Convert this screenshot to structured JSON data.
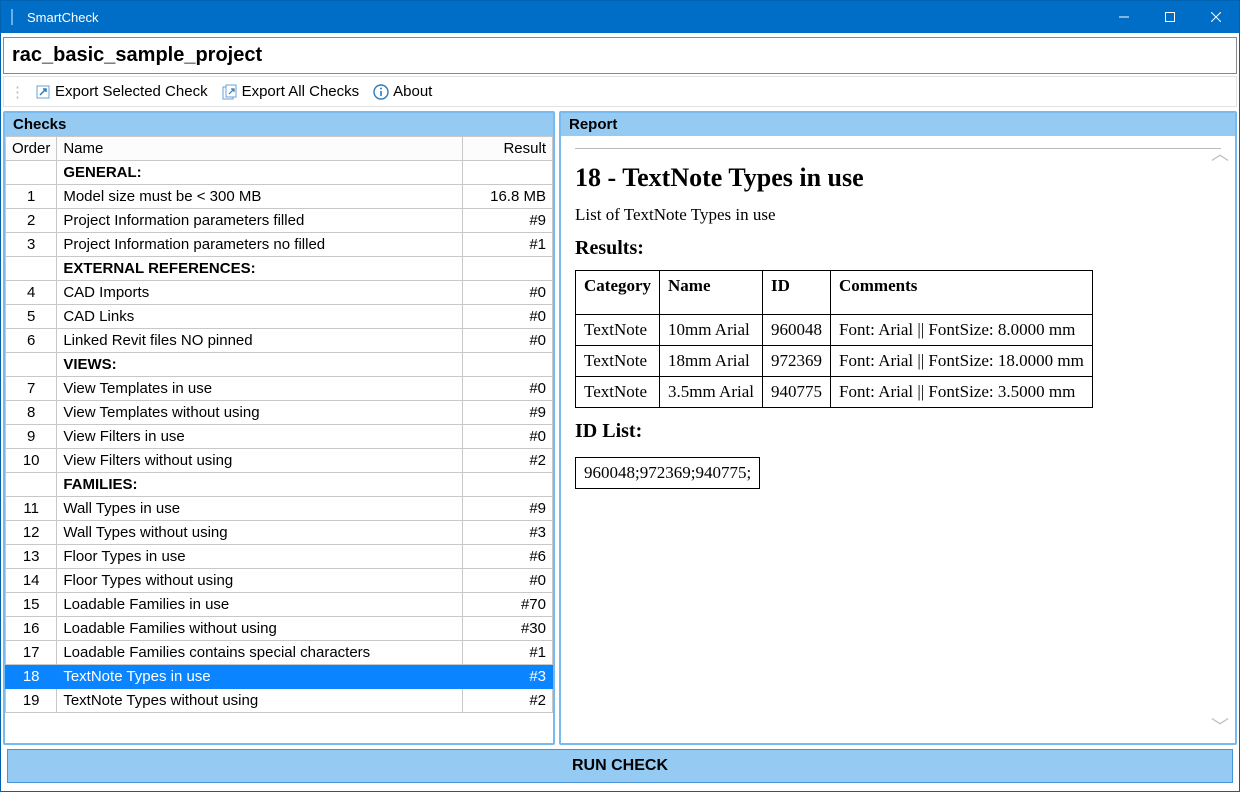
{
  "window": {
    "title": "SmartCheck"
  },
  "project": {
    "name": "rac_basic_sample_project"
  },
  "toolbar": {
    "export_selected": "Export Selected Check",
    "export_all": "Export All Checks",
    "about": "About"
  },
  "panels": {
    "checks_title": "Checks",
    "report_title": "Report"
  },
  "grid": {
    "headers": {
      "order": "Order",
      "name": "Name",
      "result": "Result"
    },
    "rows": [
      {
        "type": "section",
        "name": "GENERAL:"
      },
      {
        "type": "item",
        "order": "1",
        "name": "Model size must be < 300 MB",
        "result": "16.8 MB"
      },
      {
        "type": "item",
        "order": "2",
        "name": "Project Information parameters filled",
        "result": "#9"
      },
      {
        "type": "item",
        "order": "3",
        "name": "Project Information parameters no filled",
        "result": "#1"
      },
      {
        "type": "section",
        "name": "EXTERNAL REFERENCES:"
      },
      {
        "type": "item",
        "order": "4",
        "name": "CAD Imports",
        "result": "#0"
      },
      {
        "type": "item",
        "order": "5",
        "name": "CAD Links",
        "result": "#0"
      },
      {
        "type": "item",
        "order": "6",
        "name": "Linked Revit files NO pinned",
        "result": "#0"
      },
      {
        "type": "section",
        "name": "VIEWS:"
      },
      {
        "type": "item",
        "order": "7",
        "name": "View Templates in use",
        "result": "#0"
      },
      {
        "type": "item",
        "order": "8",
        "name": "View Templates without using",
        "result": "#9"
      },
      {
        "type": "item",
        "order": "9",
        "name": "View Filters in use",
        "result": "#0"
      },
      {
        "type": "item",
        "order": "10",
        "name": "View Filters without using",
        "result": "#2"
      },
      {
        "type": "section",
        "name": "FAMILIES:"
      },
      {
        "type": "item",
        "order": "11",
        "name": "Wall Types in use",
        "result": "#9"
      },
      {
        "type": "item",
        "order": "12",
        "name": "Wall Types without using",
        "result": "#3"
      },
      {
        "type": "item",
        "order": "13",
        "name": "Floor Types in use",
        "result": "#6"
      },
      {
        "type": "item",
        "order": "14",
        "name": "Floor Types without using",
        "result": "#0"
      },
      {
        "type": "item",
        "order": "15",
        "name": "Loadable Families in use",
        "result": "#70"
      },
      {
        "type": "item",
        "order": "16",
        "name": "Loadable Families without using",
        "result": "#30"
      },
      {
        "type": "item",
        "order": "17",
        "name": "Loadable Families contains special characters",
        "result": "#1"
      },
      {
        "type": "item",
        "order": "18",
        "name": "TextNote Types in use",
        "result": "#3",
        "selected": true
      },
      {
        "type": "item",
        "order": "19",
        "name": "TextNote Types without using",
        "result": "#2"
      }
    ]
  },
  "report": {
    "title": "18 - TextNote Types in use",
    "subtitle": "List of TextNote Types in use",
    "results_label": "Results:",
    "idlist_label": "ID List:",
    "headers": {
      "category": "Category",
      "name": "Name",
      "id": "ID",
      "comments": "Comments"
    },
    "rows": [
      {
        "category": "TextNote",
        "name": "10mm Arial",
        "id": "960048",
        "comments": "Font: Arial || FontSize: 8.0000 mm"
      },
      {
        "category": "TextNote",
        "name": "18mm Arial",
        "id": "972369",
        "comments": "Font: Arial || FontSize: 18.0000 mm"
      },
      {
        "category": "TextNote",
        "name": "3.5mm Arial",
        "id": "940775",
        "comments": "Font: Arial || FontSize: 3.5000 mm"
      }
    ],
    "idlist": "960048;972369;940775;"
  },
  "run_button": "RUN CHECK"
}
